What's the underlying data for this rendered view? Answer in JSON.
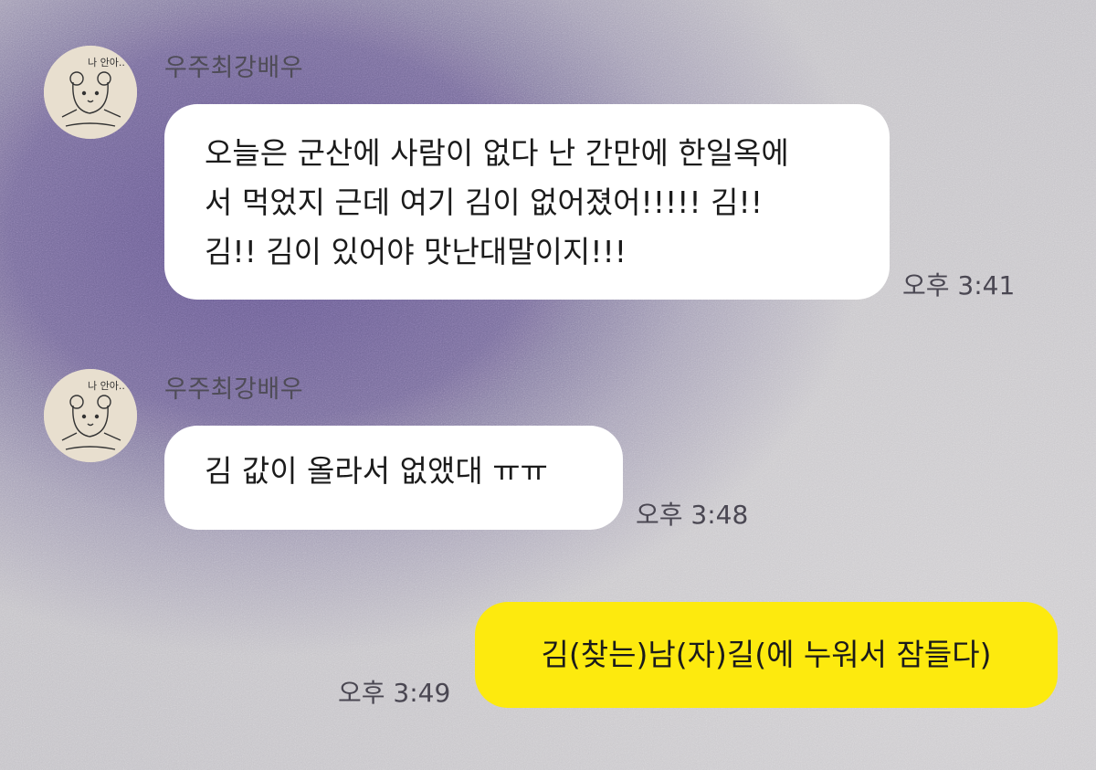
{
  "messages": [
    {
      "sender": "우주최강배우",
      "lines": [
        "오늘은 군산에 사람이 없다 난 간만에 한일옥에",
        "서 먹었지 근데 여기 김이 없어졌어!!!!! 김!!",
        "김!! 김이 있어야 맛난대말이지!!!"
      ],
      "time": "오후 3:41"
    },
    {
      "sender": "우주최강배우",
      "lines": [
        "김 값이 올라서 없앴대 ㅠㅠ"
      ],
      "time": "오후 3:48"
    },
    {
      "text": "김(찾는)남(자)길(에 누워서 잠들다)",
      "time": "오후 3:49"
    }
  ],
  "avatar": {
    "caption": "나 안아..",
    "icon": "bear-drawing-icon"
  },
  "colors": {
    "my_bubble": "#fdea0e",
    "other_bubble": "#ffffff",
    "background_purple": "#6a5c94"
  }
}
